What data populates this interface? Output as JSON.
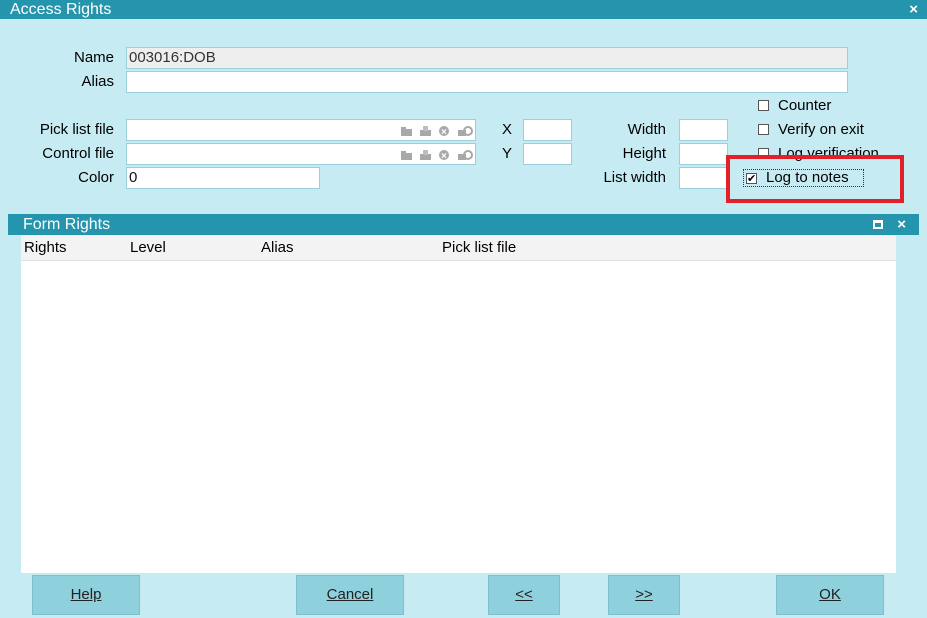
{
  "window": {
    "title": "Access Rights",
    "close": "×"
  },
  "fields": {
    "name": {
      "label": "Name",
      "value": "003016:DOB"
    },
    "alias": {
      "label": "Alias",
      "value": ""
    },
    "pick_list_file": {
      "label": "Pick list file",
      "value": ""
    },
    "control_file": {
      "label": "Control file",
      "value": ""
    },
    "color": {
      "label": "Color",
      "value": "0"
    },
    "x": {
      "label": "X",
      "value": ""
    },
    "y": {
      "label": "Y",
      "value": ""
    },
    "width": {
      "label": "Width",
      "value": ""
    },
    "height": {
      "label": "Height",
      "value": ""
    },
    "list_width": {
      "label": "List width",
      "value": ""
    }
  },
  "file_icons": [
    "folder-icon",
    "printer-icon",
    "clear-icon",
    "lock-icon"
  ],
  "checkboxes": [
    {
      "label": "Counter",
      "checked": false
    },
    {
      "label": "Verify on exit",
      "checked": false
    },
    {
      "label": "Log verification",
      "checked": false
    },
    {
      "label": "Log to notes",
      "checked": true
    }
  ],
  "highlight_color": "#e3202a",
  "subpanel": {
    "title": "Form Rights",
    "columns": [
      "Rights",
      "Level",
      "Alias",
      "Pick list file"
    ]
  },
  "buttons": {
    "help": "Help",
    "cancel": "Cancel",
    "prev": "<<",
    "next": ">>",
    "ok": "OK"
  },
  "colors": {
    "title_bar": "#2595ad",
    "background": "#c7ebf3",
    "button": "#8fd0dd"
  }
}
